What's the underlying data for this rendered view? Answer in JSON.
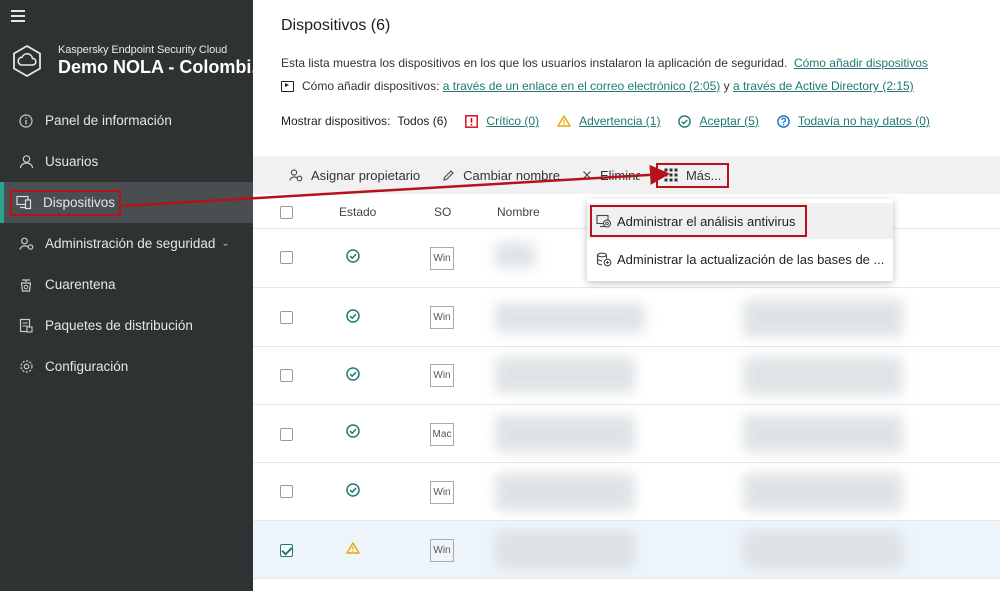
{
  "sidebar": {
    "product": "Kaspersky Endpoint Security Cloud",
    "company": "Demo NOLA - Colombi...",
    "items": [
      {
        "label": "Panel de información",
        "icon": "info-icon"
      },
      {
        "label": "Usuarios",
        "icon": "user-icon"
      },
      {
        "label": "Dispositivos",
        "icon": "devices-icon",
        "active": true
      },
      {
        "label": "Administración de seguridad",
        "icon": "security-icon",
        "expandable": true
      },
      {
        "label": "Cuarentena",
        "icon": "quarantine-icon"
      },
      {
        "label": "Paquetes de distribución",
        "icon": "packages-icon"
      },
      {
        "label": "Configuración",
        "icon": "gear-icon"
      }
    ]
  },
  "main": {
    "title": "Dispositivos (6)",
    "description": "Esta lista muestra los dispositivos en los que los usuarios instalaron la aplicación de seguridad.",
    "how_to_link": "Cómo añadir dispositivos",
    "video_prefix": "Cómo añadir dispositivos:",
    "video_link_email": "a través de un enlace en el correo electrónico (2:05)",
    "video_and": "y",
    "video_link_ad": "a través de Active Directory (2:15)",
    "filters": {
      "label": "Mostrar dispositivos:",
      "all": "Todos (6)",
      "critical": "Crítico (0)",
      "warning": "Advertencia (1)",
      "ok": "Aceptar (5)",
      "nodata": "Todavía no hay datos (0)"
    }
  },
  "toolbar": {
    "assign_owner": "Asignar propietario",
    "rename": "Cambiar nombre",
    "delete": "Eliminar",
    "more": "Más..."
  },
  "table": {
    "columns": {
      "status": "Estado",
      "os": "SO",
      "name": "Nombre"
    },
    "rows": [
      {
        "status": "ok",
        "os": "Win",
        "checked": false
      },
      {
        "status": "ok",
        "os": "Win",
        "checked": false
      },
      {
        "status": "ok",
        "os": "Win",
        "checked": false
      },
      {
        "status": "ok",
        "os": "Mac",
        "checked": false
      },
      {
        "status": "ok",
        "os": "Win",
        "checked": false
      },
      {
        "status": "warning",
        "os": "Win",
        "checked": true
      }
    ]
  },
  "dropdown": {
    "items": [
      {
        "label": "Administrar el análisis antivirus",
        "icon": "antivirus-scan-icon"
      },
      {
        "label": "Administrar la actualización de las bases de ...",
        "icon": "database-update-icon"
      }
    ]
  },
  "colors": {
    "sidebar_bg": "#2f3233",
    "accent": "#2aa58b",
    "link": "#1f7a70",
    "highlight": "#b5121b",
    "critical": "#d0021b",
    "warning": "#e6a800"
  }
}
